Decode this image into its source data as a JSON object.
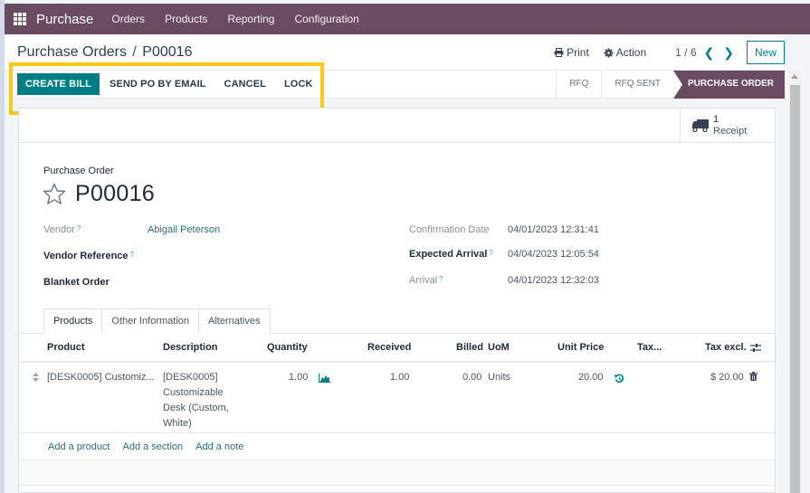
{
  "navbar": {
    "app_name": "Purchase",
    "menu": [
      "Orders",
      "Products",
      "Reporting",
      "Configuration"
    ]
  },
  "control_panel": {
    "breadcrumb_parent": "Purchase Orders",
    "breadcrumb_separator": "/",
    "breadcrumb_current": "P00016",
    "print_label": "Print",
    "action_label": "Action",
    "pager": "1 / 6",
    "new_label": "New"
  },
  "statusbar": {
    "buttons": [
      "CREATE BILL",
      "SEND PO BY EMAIL",
      "CANCEL",
      "LOCK"
    ],
    "stages": [
      "RFQ",
      "RFQ SENT",
      "PURCHASE ORDER"
    ],
    "active_stage": "PURCHASE ORDER"
  },
  "smart_button": {
    "count": "1",
    "label": "Receipt"
  },
  "form": {
    "title_label": "Purchase Order",
    "name": "P00016",
    "left_fields": [
      {
        "label": "Vendor",
        "value": "Abigail Peterson",
        "help": "?"
      },
      {
        "label": "Vendor Reference",
        "value": "",
        "help": "?"
      },
      {
        "label": "Blanket Order",
        "value": ""
      }
    ],
    "right_fields": [
      {
        "label": "Confirmation Date",
        "value": "04/01/2023 12:31:41"
      },
      {
        "label": "Expected Arrival",
        "value": "04/04/2023 12:05:54",
        "help": "?"
      },
      {
        "label": "Arrival",
        "value": "04/01/2023 12:32:03",
        "help": "?"
      }
    ]
  },
  "tabs": [
    "Products",
    "Other Information",
    "Alternatives"
  ],
  "table": {
    "columns": [
      "Product",
      "Description",
      "Quantity",
      "Received",
      "Billed",
      "UoM",
      "Unit Price",
      "Tax...",
      "Tax excl."
    ],
    "rows": [
      {
        "product": "[DESK0005] Customiz...",
        "description_lines": [
          "[DESK0005]",
          "Customizable",
          "Desk (Custom,",
          "White)"
        ],
        "quantity": "1.00",
        "received": "1.00",
        "billed": "0.00",
        "uom": "Units",
        "unit_price": "20.00",
        "taxes": "",
        "subtotal": "$ 20.00"
      }
    ],
    "add_links": [
      "Add a product",
      "Add a section",
      "Add a note"
    ]
  },
  "colors": {
    "navbar": "#6a4b62",
    "primary": "#017e84",
    "highlight": "#fcc81a",
    "link": "#2f6b7d"
  }
}
